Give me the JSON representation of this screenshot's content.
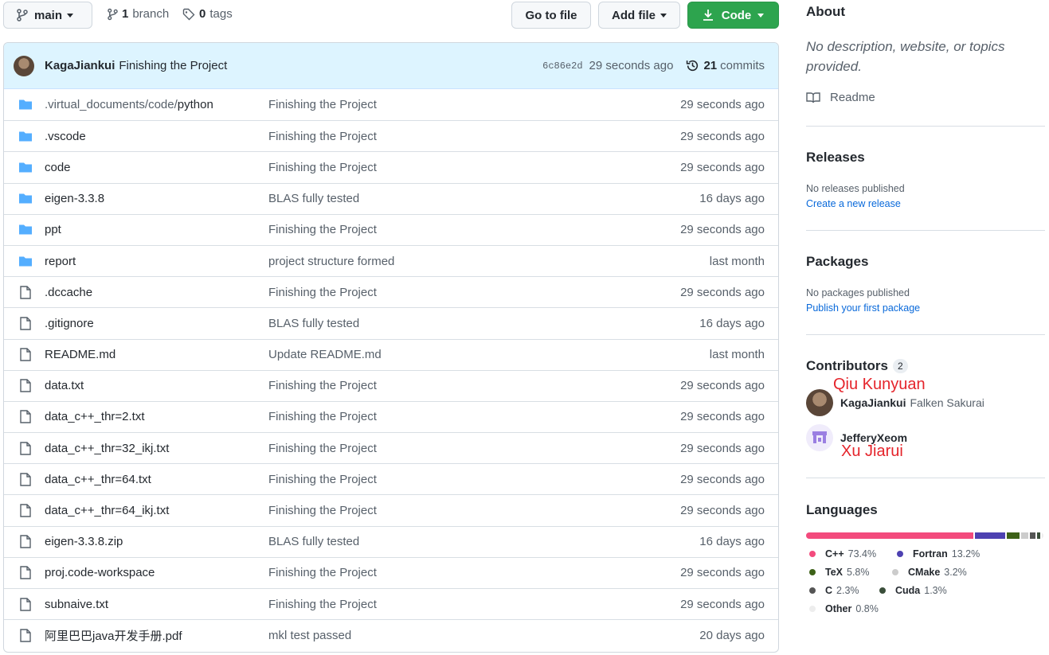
{
  "header": {
    "branch": "main",
    "branch_count": "1",
    "branch_label": "branch",
    "tag_count": "0",
    "tag_label": "tags",
    "go_to_file": "Go to file",
    "add_file": "Add file",
    "code": "Code"
  },
  "commit": {
    "author": "KagaJiankui",
    "message": "Finishing the Project",
    "hash": "6c86e2d",
    "time": "29 seconds ago",
    "count": "21",
    "count_label": "commits"
  },
  "files": [
    {
      "type": "dir",
      "prefix": ".virtual_documents/code/",
      "name": "python",
      "message": "Finishing the Project",
      "age": "29 seconds ago"
    },
    {
      "type": "dir",
      "prefix": "",
      "name": ".vscode",
      "message": "Finishing the Project",
      "age": "29 seconds ago"
    },
    {
      "type": "dir",
      "prefix": "",
      "name": "code",
      "message": "Finishing the Project",
      "age": "29 seconds ago"
    },
    {
      "type": "dir",
      "prefix": "",
      "name": "eigen-3.3.8",
      "message": "BLAS fully tested",
      "age": "16 days ago"
    },
    {
      "type": "dir",
      "prefix": "",
      "name": "ppt",
      "message": "Finishing the Project",
      "age": "29 seconds ago"
    },
    {
      "type": "dir",
      "prefix": "",
      "name": "report",
      "message": "project structure formed",
      "age": "last month"
    },
    {
      "type": "file",
      "prefix": "",
      "name": ".dccache",
      "message": "Finishing the Project",
      "age": "29 seconds ago"
    },
    {
      "type": "file",
      "prefix": "",
      "name": ".gitignore",
      "message": "BLAS fully tested",
      "age": "16 days ago"
    },
    {
      "type": "file",
      "prefix": "",
      "name": "README.md",
      "message": "Update README.md",
      "age": "last month"
    },
    {
      "type": "file",
      "prefix": "",
      "name": "data.txt",
      "message": "Finishing the Project",
      "age": "29 seconds ago"
    },
    {
      "type": "file",
      "prefix": "",
      "name": "data_c++_thr=2.txt",
      "message": "Finishing the Project",
      "age": "29 seconds ago"
    },
    {
      "type": "file",
      "prefix": "",
      "name": "data_c++_thr=32_ikj.txt",
      "message": "Finishing the Project",
      "age": "29 seconds ago"
    },
    {
      "type": "file",
      "prefix": "",
      "name": "data_c++_thr=64.txt",
      "message": "Finishing the Project",
      "age": "29 seconds ago"
    },
    {
      "type": "file",
      "prefix": "",
      "name": "data_c++_thr=64_ikj.txt",
      "message": "Finishing the Project",
      "age": "29 seconds ago"
    },
    {
      "type": "file",
      "prefix": "",
      "name": "eigen-3.3.8.zip",
      "message": "BLAS fully tested",
      "age": "16 days ago"
    },
    {
      "type": "file",
      "prefix": "",
      "name": "proj.code-workspace",
      "message": "Finishing the Project",
      "age": "29 seconds ago"
    },
    {
      "type": "file",
      "prefix": "",
      "name": "subnaive.txt",
      "message": "Finishing the Project",
      "age": "29 seconds ago"
    },
    {
      "type": "file",
      "prefix": "",
      "name": "阿里巴巴java开发手册.pdf",
      "message": "mkl test passed",
      "age": "20 days ago"
    }
  ],
  "about": {
    "title": "About",
    "description": "No description, website, or topics provided.",
    "readme": "Readme"
  },
  "releases": {
    "title": "Releases",
    "empty": "No releases published",
    "link": "Create a new release"
  },
  "packages": {
    "title": "Packages",
    "empty": "No packages published",
    "link": "Publish your first package"
  },
  "contributors": {
    "title": "Contributors",
    "count": "2",
    "items": [
      {
        "login": "KagaJiankui",
        "name": "Falken Sakurai",
        "annotation": "Qiu Kunyuan"
      },
      {
        "login": "JefferyXeom",
        "name": "",
        "annotation": "Xu Jiarui"
      }
    ]
  },
  "languages": {
    "title": "Languages",
    "items": [
      {
        "name": "C++",
        "percent": "73.4%",
        "color": "#f34b7d"
      },
      {
        "name": "Fortran",
        "percent": "13.2%",
        "color": "#4d41b1"
      },
      {
        "name": "TeX",
        "percent": "5.8%",
        "color": "#3d6117"
      },
      {
        "name": "CMake",
        "percent": "3.2%",
        "color": "#cccccc"
      },
      {
        "name": "C",
        "percent": "2.3%",
        "color": "#555555"
      },
      {
        "name": "Cuda",
        "percent": "1.3%",
        "color": "#3a4e3a"
      },
      {
        "name": "Other",
        "percent": "0.8%",
        "color": "#ededed"
      }
    ]
  },
  "annotation_color": "#e5242b"
}
